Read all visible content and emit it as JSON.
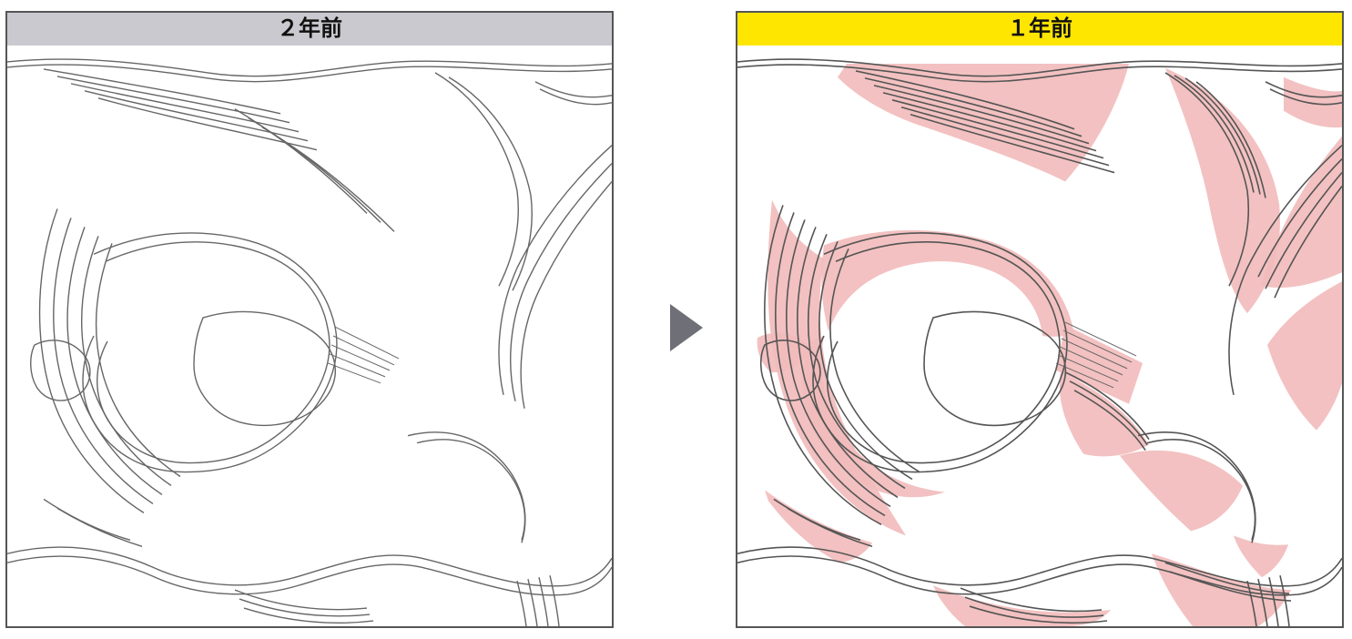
{
  "panels": {
    "left": {
      "title": "２年前"
    },
    "right": {
      "title": "１年前"
    }
  },
  "arrow_color": "#6f6f78"
}
